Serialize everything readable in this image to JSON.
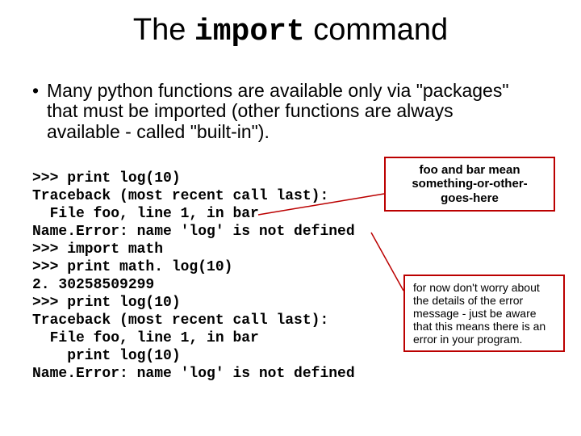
{
  "title": {
    "pre": "The ",
    "kw": "import",
    "post": " command"
  },
  "bullet": {
    "dot": "•",
    "text": "Many python functions are available only via \"packages\" that must be imported (other functions are always available - called \"built-in\")."
  },
  "code": {
    "l0": ">>> print log(10)",
    "l1": "Traceback (most recent call last):",
    "l2": "  File foo, line 1, in bar",
    "l3": "Name.Error: name 'log' is not defined",
    "l4": ">>> import math",
    "l5": ">>> print math. log(10)",
    "l6": "2. 30258509299",
    "l7": ">>> print log(10)",
    "l8": "Traceback (most recent call last):",
    "l9": "  File foo, line 1, in bar",
    "l10": "    print log(10)",
    "l11": "Name.Error: name 'log' is not defined"
  },
  "callout1": {
    "l0": "foo and bar mean",
    "l1": "something-or-other-",
    "l2": "goes-here"
  },
  "callout2": {
    "text": "for now don't worry about the details of the error message - just be aware that this means there is an error in your program."
  }
}
